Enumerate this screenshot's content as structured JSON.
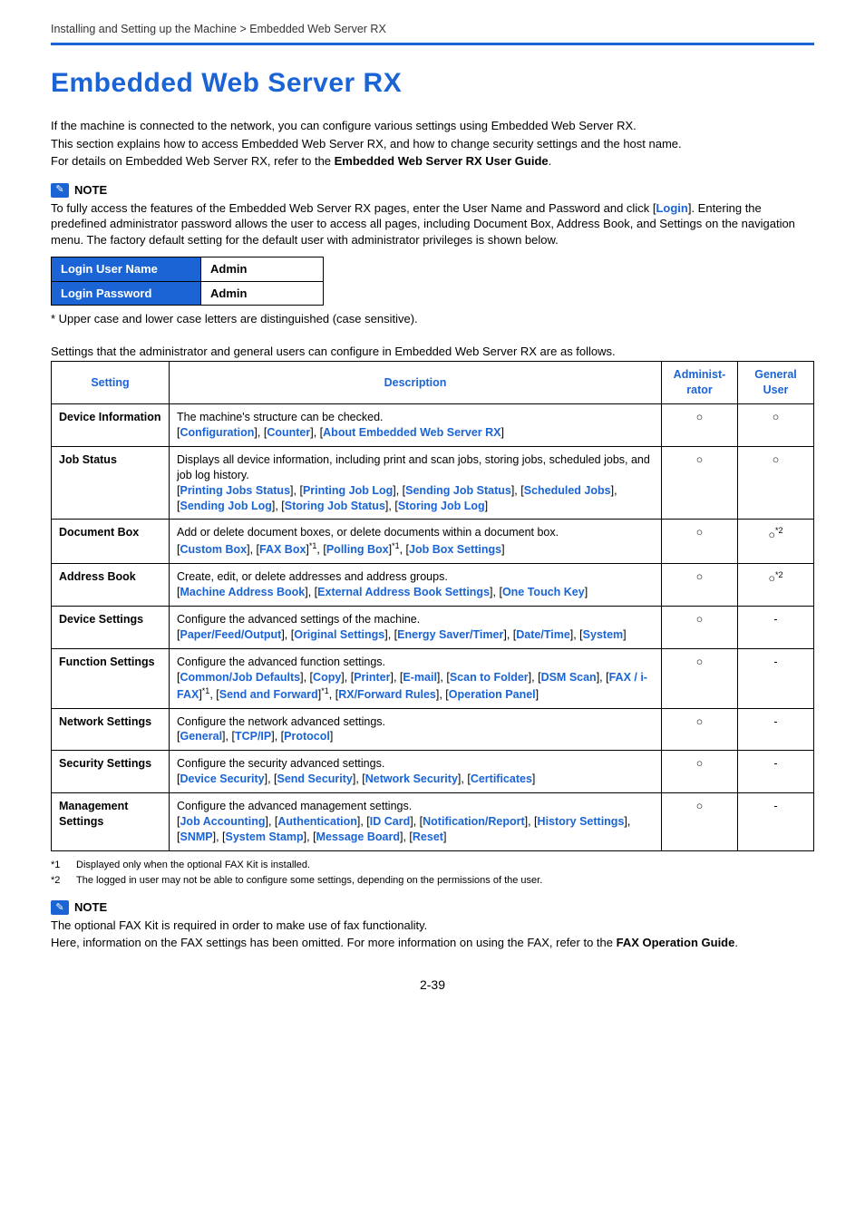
{
  "breadcrumb": "Installing and Setting up the Machine > Embedded Web Server RX",
  "title": "Embedded Web Server RX",
  "intro": {
    "p1": "If the machine is connected to the network, you can configure various settings using Embedded Web Server RX.",
    "p2": "This section explains how to access Embedded Web Server RX, and how to change security settings and the host name.",
    "p3a": "For details on Embedded Web Server RX, refer to the ",
    "p3b": "Embedded Web Server RX User Guide",
    "p3c": "."
  },
  "note1": {
    "label": "NOTE",
    "t1": "To fully access the features of the Embedded Web Server RX pages, enter the User Name and Password and click [",
    "login": "Login",
    "t2": "]. Entering the predefined administrator password allows the user to access all pages, including Document Box, Address Book, and Settings on the navigation menu. The factory default setting for the default user with administrator privileges is shown below."
  },
  "login": {
    "row1h": "Login User Name",
    "row1v": "Admin",
    "row2h": "Login Password",
    "row2v": "Admin"
  },
  "case_note": "* Upper case and lower case letters are distinguished (case sensitive).",
  "settings_intro": "Settings that the administrator and general users can configure in Embedded Web Server RX are as follows.",
  "headers": {
    "setting": "Setting",
    "description": "Description",
    "admin": "Administ-rator",
    "user": "General User"
  },
  "rows": {
    "r0": {
      "setting": "Device Information",
      "desc_text": "The machine's structure can be checked.",
      "links": [
        "Configuration",
        "Counter",
        "About Embedded Web Server RX"
      ],
      "admin": "circle",
      "user": "circle"
    },
    "r1": {
      "setting": "Job Status",
      "desc_text": "Displays all device information, including print and scan jobs, storing jobs, scheduled jobs, and job log history.",
      "links": [
        "Printing Jobs Status",
        "Printing Job Log",
        "Sending Job Status",
        "Scheduled Jobs",
        "Sending Job Log",
        "Storing Job Status",
        "Storing Job Log"
      ],
      "admin": "circle",
      "user": "circle"
    },
    "r2": {
      "setting": "Document Box",
      "desc_text": "Add or delete document boxes, or delete documents within a document box.",
      "admin": "circle",
      "user": "circle*2"
    },
    "r3": {
      "setting": "Address Book",
      "desc_text": "Create, edit, or delete addresses and address groups.",
      "links": [
        "Machine Address Book",
        "External Address Book Settings",
        "One Touch Key"
      ],
      "admin": "circle",
      "user": "circle*2"
    },
    "r4": {
      "setting": "Device Settings",
      "desc_text": "Configure the advanced settings of the machine.",
      "links": [
        "Paper/Feed/Output",
        "Original Settings",
        "Energy Saver/Timer",
        "Date/Time",
        "System"
      ],
      "admin": "circle",
      "user": "-"
    },
    "r5": {
      "setting": "Function Settings",
      "desc_text": "Configure the advanced function settings.",
      "admin": "circle",
      "user": "-"
    },
    "r6": {
      "setting": "Network Settings",
      "desc_text": "Configure the network advanced settings.",
      "links": [
        "General",
        "TCP/IP",
        "Protocol"
      ],
      "admin": "circle",
      "user": "-"
    },
    "r7": {
      "setting": "Security Settings",
      "desc_text": "Configure the security advanced settings.",
      "links": [
        "Device Security",
        "Send Security",
        "Network Security",
        "Certificates"
      ],
      "admin": "circle",
      "user": "-"
    },
    "r8": {
      "setting": "Management Settings",
      "desc_text": "Configure the advanced management settings.",
      "links": [
        "Job Accounting",
        "Authentication",
        "ID Card",
        "Notification/Report",
        "History Settings",
        "SNMP",
        "System Stamp",
        "Message Board",
        "Reset"
      ],
      "admin": "circle",
      "user": "-"
    }
  },
  "footnotes": {
    "f1": "Displayed only when the optional FAX Kit is installed.",
    "f2": "The logged in user may not be able to configure some settings, depending on the permissions of the user."
  },
  "note2": {
    "label": "NOTE",
    "t1": "The optional FAX Kit is required in order to make use of fax functionality.",
    "t2a": "Here, information on the FAX settings has been omitted. For more information on using the FAX, refer to the ",
    "t2b": "FAX Operation Guide",
    "t2c": "."
  },
  "page_num": "2-39"
}
